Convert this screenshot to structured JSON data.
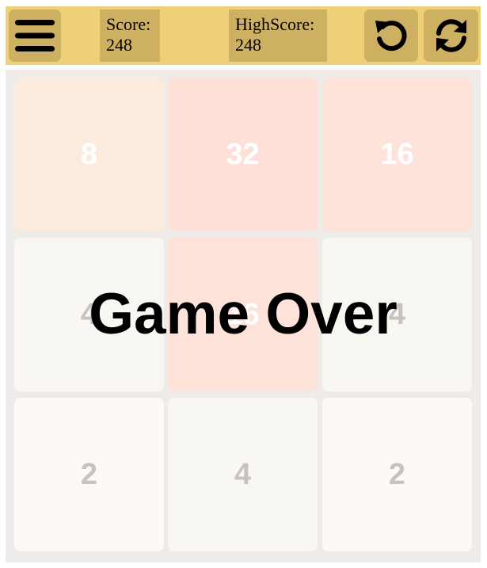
{
  "header": {
    "score_label": "Score:",
    "score_value": "248",
    "highscore_label": "HighScore:",
    "highscore_value": "248",
    "menu_icon": "hamburger-menu-icon",
    "undo_icon": "undo-icon",
    "restart_icon": "restart-icon",
    "bar_color": "#eed077",
    "button_color": "#cdb061"
  },
  "board": {
    "background": "#efebe9",
    "tiles": [
      {
        "value": "8",
        "bg": "#fcebdd",
        "text": "#ffffff"
      },
      {
        "value": "32",
        "bg": "#fde0d7",
        "text": "#ffffff"
      },
      {
        "value": "16",
        "bg": "#fde3d9",
        "text": "#ffffff"
      },
      {
        "value": "4",
        "bg": "#f9f7f1",
        "text": "#c5c2c0"
      },
      {
        "value": "16",
        "bg": "#fde3d9",
        "text": "#ffffff"
      },
      {
        "value": "4",
        "bg": "#f9f7f1",
        "text": "#c5c2c0"
      },
      {
        "value": "2",
        "bg": "#fcf9f6",
        "text": "#c5c2c0"
      },
      {
        "value": "4",
        "bg": "#f9f7f1",
        "text": "#c5c2c0"
      },
      {
        "value": "2",
        "bg": "#fcf9f6",
        "text": "#c5c2c0"
      }
    ]
  },
  "overlay": {
    "message": "Game Over"
  }
}
